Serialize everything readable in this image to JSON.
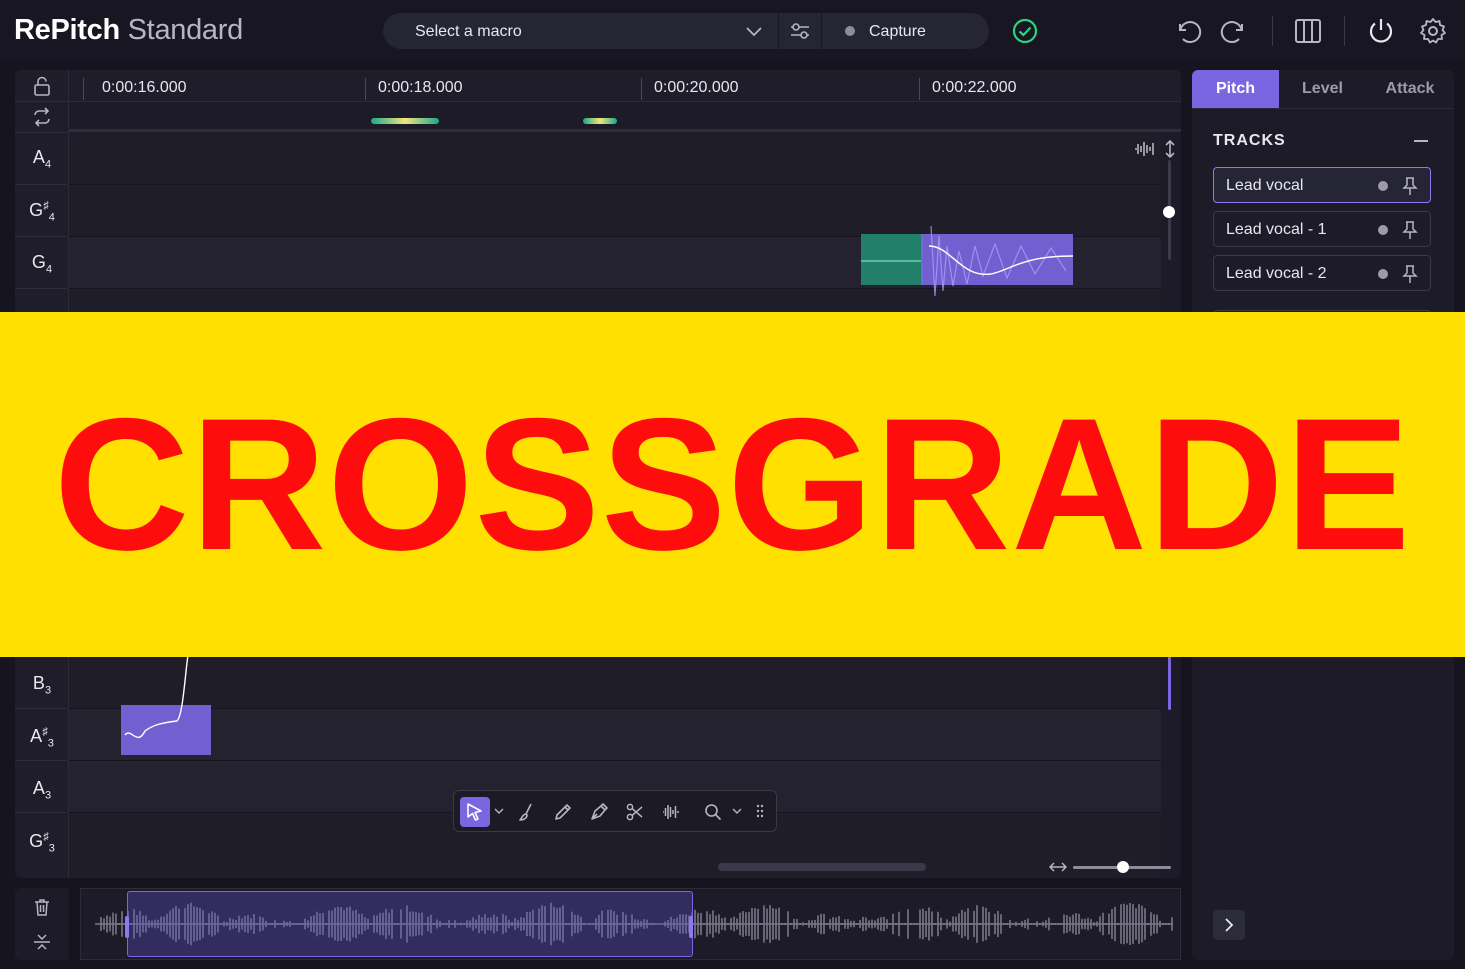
{
  "brand": {
    "name_bold": "RePitch",
    "name_light": "Standard"
  },
  "toolbar": {
    "macro_placeholder": "Select a macro",
    "capture_label": "Capture"
  },
  "ruler": {
    "times": [
      "0:00:16.000",
      "0:00:18.000",
      "0:00:20.000",
      "0:00:22.000"
    ]
  },
  "keys": [
    {
      "note": "A",
      "accidental": "",
      "octave": "4"
    },
    {
      "note": "G",
      "accidental": "♯",
      "octave": "4"
    },
    {
      "note": "G",
      "accidental": "",
      "octave": "4"
    },
    {
      "note": "B",
      "accidental": "",
      "octave": "3"
    },
    {
      "note": "A",
      "accidental": "♯",
      "octave": "3"
    },
    {
      "note": "A",
      "accidental": "",
      "octave": "3"
    },
    {
      "note": "G",
      "accidental": "♯",
      "octave": "3"
    }
  ],
  "right_panel": {
    "tabs": [
      "Pitch",
      "Level",
      "Attack"
    ],
    "active_tab": "Pitch",
    "tracks_title": "TRACKS",
    "tracks": [
      "Lead vocal",
      "Lead vocal - 1",
      "Lead vocal - 2"
    ]
  },
  "banner": {
    "text": "CROSSGRADE"
  },
  "colors": {
    "accent": "#7a66e0",
    "note_green": "#22806a",
    "ok_green": "#2bd67b",
    "banner_bg": "#ffe000",
    "banner_text": "#ff0d0d"
  }
}
